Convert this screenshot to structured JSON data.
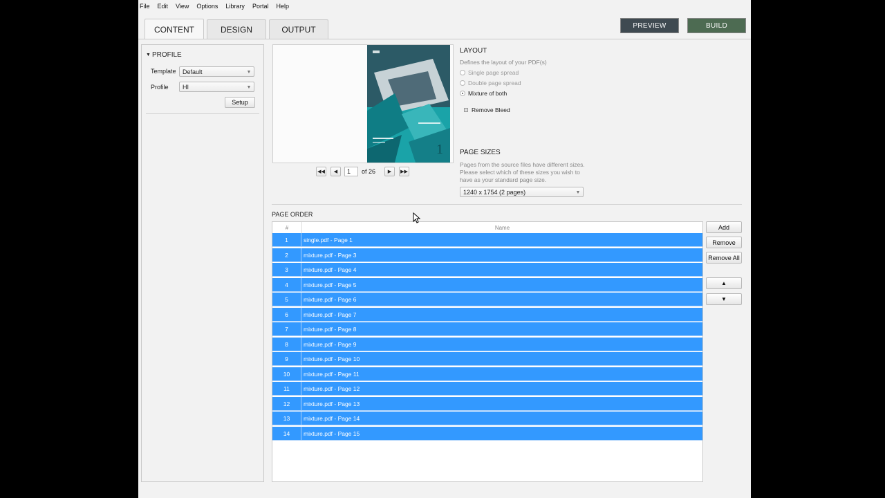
{
  "menu": [
    "File",
    "Edit",
    "View",
    "Options",
    "Library",
    "Portal",
    "Help"
  ],
  "tabs": {
    "content": "CONTENT",
    "design": "DESIGN",
    "output": "OUTPUT"
  },
  "actions": {
    "preview": "PREVIEW",
    "build": "BUILD"
  },
  "profile": {
    "title": "PROFILE",
    "template_label": "Template",
    "template_value": "Default",
    "profile_label": "Profile",
    "profile_value": "HI",
    "setup_button": "Setup"
  },
  "pager": {
    "current": "1",
    "of_text": "of 26"
  },
  "layout": {
    "title": "LAYOUT",
    "description": "Defines the layout of your PDF(s)",
    "options": [
      "Single page spread",
      "Double page spread",
      "Mixture of both"
    ],
    "selected": "Mixture of both",
    "remove_bleed": "Remove Bleed"
  },
  "page_sizes": {
    "title": "PAGE SIZES",
    "description_lines": [
      "Pages from the source files have different sizes.",
      "Please select which of these sizes you wish to",
      "have as your standard page size."
    ],
    "selected": "1240 x 1754 (2 pages)"
  },
  "page_order": {
    "title": "PAGE ORDER",
    "columns": [
      "#",
      "Name"
    ],
    "rows": [
      {
        "num": "1",
        "name": "single.pdf - Page 1"
      },
      {
        "num": "2",
        "name": "mixture.pdf - Page 3"
      },
      {
        "num": "3",
        "name": "mixture.pdf - Page 4"
      },
      {
        "num": "4",
        "name": "mixture.pdf - Page 5"
      },
      {
        "num": "5",
        "name": "mixture.pdf - Page 6"
      },
      {
        "num": "6",
        "name": "mixture.pdf - Page 7"
      },
      {
        "num": "7",
        "name": "mixture.pdf - Page 8"
      },
      {
        "num": "8",
        "name": "mixture.pdf - Page 9"
      },
      {
        "num": "9",
        "name": "mixture.pdf - Page 10"
      },
      {
        "num": "10",
        "name": "mixture.pdf - Page 11"
      },
      {
        "num": "11",
        "name": "mixture.pdf - Page 12"
      },
      {
        "num": "12",
        "name": "mixture.pdf - Page 13"
      },
      {
        "num": "13",
        "name": "mixture.pdf - Page 14"
      },
      {
        "num": "14",
        "name": "mixture.pdf - Page 15"
      }
    ],
    "buttons": {
      "add": "Add",
      "remove": "Remove",
      "remove_all": "Remove All"
    }
  },
  "cover": {
    "page_number": "1"
  },
  "icons": {
    "first": "first-page-icon",
    "prev": "previous-page-icon",
    "next": "next-page-icon",
    "last": "last-page-icon",
    "up": "move-up-icon",
    "down": "move-down-icon",
    "collapse": "collapse-triangle-icon",
    "cursor": "mouse-cursor-icon"
  },
  "colors": {
    "selection": "#3399ff",
    "preview_button": "#3f4a51",
    "build_button": "#4d6b52",
    "cover_teal": "#1aa3a8"
  }
}
